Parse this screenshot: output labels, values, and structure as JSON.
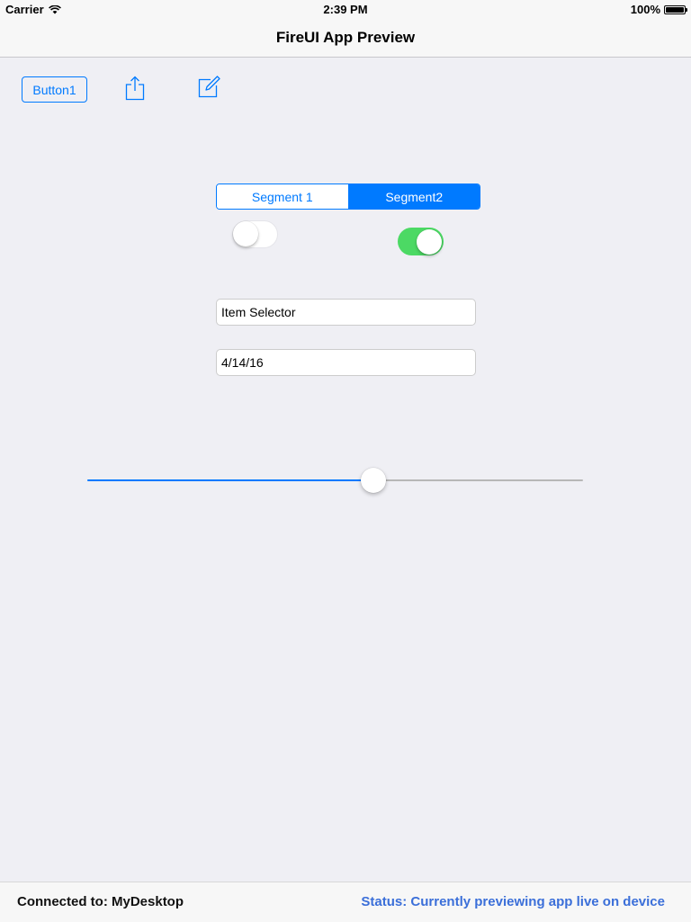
{
  "status_bar": {
    "carrier": "Carrier",
    "time": "2:39 PM",
    "battery": "100%",
    "battery_level": 1.0
  },
  "nav": {
    "title": "FireUI App Preview"
  },
  "toolbar": {
    "button1_label": "Button1",
    "share_icon": "share-icon",
    "compose_icon": "compose-icon"
  },
  "segmented_control": {
    "segments": [
      {
        "label": "Segment 1",
        "selected": false
      },
      {
        "label": "Segment2",
        "selected": true
      }
    ]
  },
  "switches": [
    {
      "state": "off"
    },
    {
      "state": "on"
    }
  ],
  "fields": {
    "item_selector": "Item Selector",
    "date": "4/14/16"
  },
  "slider": {
    "value": 0.578
  },
  "bottom_bar": {
    "connection": "Connected to: MyDesktop",
    "status": "Status: Currently previewing app live on device"
  },
  "colors": {
    "accent": "#007aff",
    "switch_on": "#4cd964",
    "status_text": "#3b6fd9",
    "background": "#efeff4"
  }
}
